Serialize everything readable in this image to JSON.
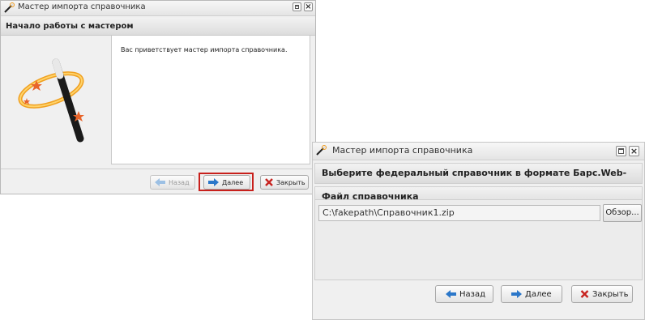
{
  "window1": {
    "title": "Мастер импорта справочника",
    "header": "Начало работы с мастером",
    "welcome_text": "Вас приветствует мастер импорта справочника.",
    "buttons": {
      "back": "Назад",
      "next": "Далее",
      "close": "Закрыть"
    },
    "icons": [
      "wand-icon",
      "maximize-icon",
      "close-icon",
      "wizard-wand-illustration",
      "arrow-left-icon",
      "arrow-right-icon",
      "x-icon"
    ]
  },
  "window2": {
    "title": "Мастер импорта справочника",
    "header": "Выберите федеральный справочник в формате Барс.Web-своды",
    "section": "Файл справочника",
    "file_value": "C:\\fakepath\\Справочник1.zip",
    "browse_label": "Обзор...",
    "buttons": {
      "back": "Назад",
      "next": "Далее",
      "close": "Закрыть"
    }
  },
  "colors": {
    "highlight": "#c8201c",
    "arrow": "#2b77c9",
    "close_x": "#c7231f"
  }
}
